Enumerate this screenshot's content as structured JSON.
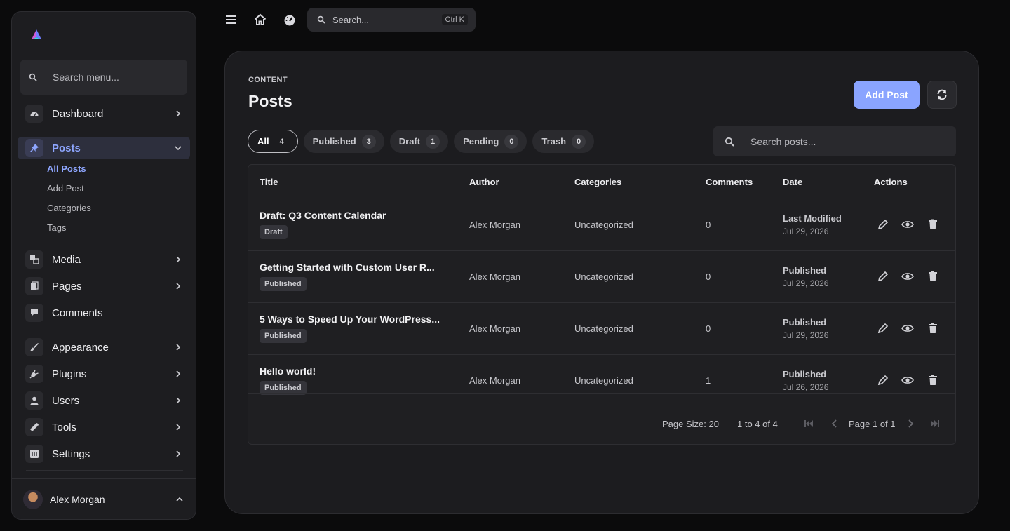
{
  "sidebar": {
    "search_placeholder": "Search menu...",
    "items": [
      {
        "label": "Dashboard",
        "icon": "gauge-icon"
      },
      {
        "label": "Posts",
        "icon": "pin-icon"
      },
      {
        "label": "Media",
        "icon": "media-icon"
      },
      {
        "label": "Pages",
        "icon": "pages-icon"
      },
      {
        "label": "Comments",
        "icon": "comment-icon"
      },
      {
        "label": "Appearance",
        "icon": "brush-icon"
      },
      {
        "label": "Plugins",
        "icon": "plug-icon"
      },
      {
        "label": "Users",
        "icon": "user-icon"
      },
      {
        "label": "Tools",
        "icon": "wrench-icon"
      },
      {
        "label": "Settings",
        "icon": "settings-icon"
      }
    ],
    "posts_submenu": [
      "All Posts",
      "Add Post",
      "Categories",
      "Tags"
    ],
    "user_name": "Alex Morgan"
  },
  "topbar": {
    "search_placeholder": "Search...",
    "shortcut": "Ctrl K"
  },
  "main": {
    "breadcrumb": "CONTENT",
    "title": "Posts",
    "add_button": "Add Post",
    "tabs": [
      {
        "label": "All",
        "count": "4"
      },
      {
        "label": "Published",
        "count": "3"
      },
      {
        "label": "Draft",
        "count": "1"
      },
      {
        "label": "Pending",
        "count": "0"
      },
      {
        "label": "Trash",
        "count": "0"
      }
    ],
    "search_placeholder": "Search posts...",
    "columns": [
      "Title",
      "Author",
      "Categories",
      "Comments",
      "Date",
      "Actions"
    ],
    "rows": [
      {
        "title": "Draft: Q3 Content Calendar",
        "badge": "Draft",
        "author": "Alex Morgan",
        "category": "Uncategorized",
        "comments": "0",
        "status": "Last Modified",
        "date": "Jul 29, 2026"
      },
      {
        "title": "Getting Started with Custom User R...",
        "badge": "Published",
        "author": "Alex Morgan",
        "category": "Uncategorized",
        "comments": "0",
        "status": "Published",
        "date": "Jul 29, 2026"
      },
      {
        "title": "5 Ways to Speed Up Your WordPress...",
        "badge": "Published",
        "author": "Alex Morgan",
        "category": "Uncategorized",
        "comments": "0",
        "status": "Published",
        "date": "Jul 29, 2026"
      },
      {
        "title": "Hello world!",
        "badge": "Published",
        "author": "Alex Morgan",
        "category": "Uncategorized",
        "comments": "1",
        "status": "Published",
        "date": "Jul 26, 2026"
      }
    ],
    "pagination": {
      "page_size": "Page Size: 20",
      "range": "1 to 4 of 4",
      "page": "Page 1 of 1"
    }
  },
  "colors": {
    "accent": "#8ea6ff",
    "button": "#8aa4ff",
    "background": "#0b0b0c"
  }
}
